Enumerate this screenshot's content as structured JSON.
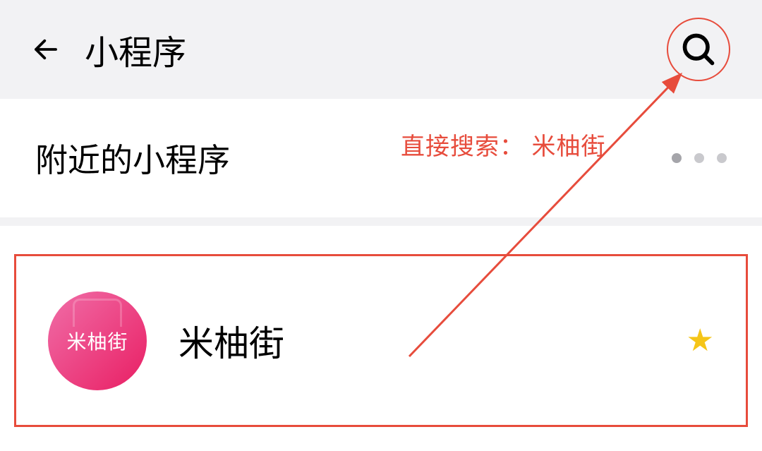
{
  "header": {
    "title": "小程序"
  },
  "section": {
    "nearby_label": "附近的小程序"
  },
  "app": {
    "icon_text": "米柚街",
    "name": "米柚街"
  },
  "annotation": {
    "text": "直接搜索：  米柚街"
  },
  "colors": {
    "annotation": "#e74c3c",
    "star": "#f5c518"
  }
}
